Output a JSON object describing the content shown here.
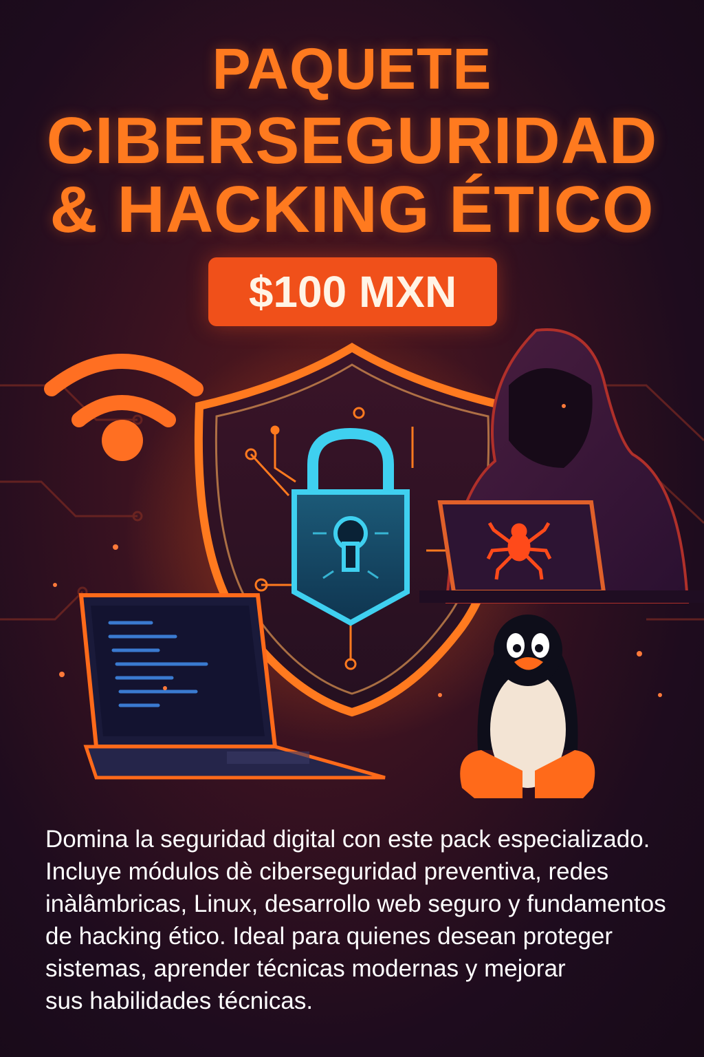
{
  "title": {
    "line1": "PAQUETE",
    "line2": "CIBERSEGURIDAD",
    "line3": "& HACKING ÉTICO"
  },
  "price": "$100 MXN",
  "description": {
    "lines": [
      " Domina la seguridad digital con este pack especializado.",
      "Incluye módulos dè ciberseguridad preventiva, redes",
      "inàlâmbricas, Linux, desarrollo web seguro y fundamentos",
      "de hacking ético. Ideal para quienes desean proteger",
      "sistemas, aprender técnicas modernas y mejorar",
      "sus habilidades técnicas."
    ]
  },
  "illustration": {
    "icons": [
      "wifi-icon",
      "shield-icon",
      "padlock-icon",
      "laptop-icon",
      "hooded-hacker-icon",
      "spider-icon",
      "penguin-icon"
    ],
    "colors": {
      "accent": "#ff7a1f",
      "badge": "#f0501a",
      "lock": "#3fd0f0",
      "background": "#1e0c1e"
    }
  }
}
